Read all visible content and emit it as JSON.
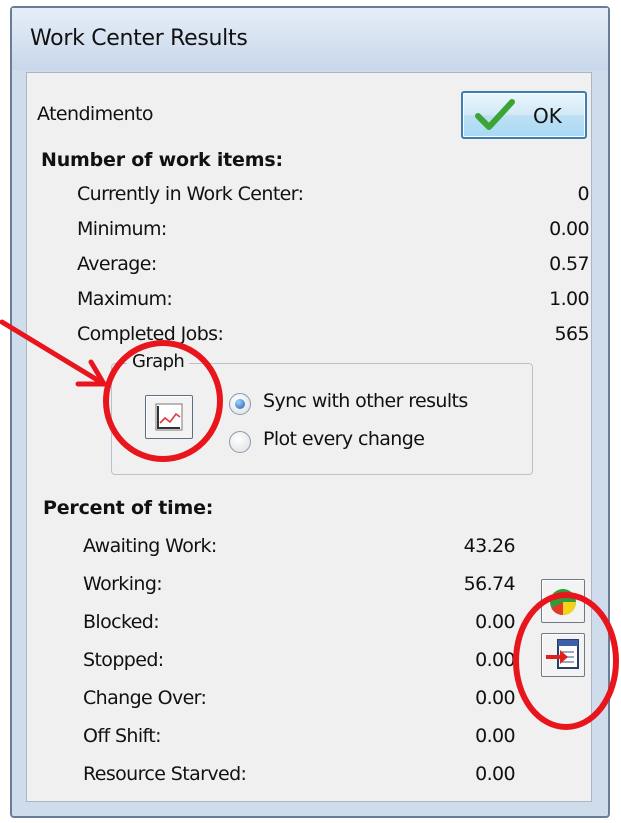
{
  "window": {
    "title": "Work Center Results"
  },
  "header": {
    "name": "Atendimento",
    "ok_label": "OK"
  },
  "work_items": {
    "heading": "Number of work items:",
    "rows": [
      {
        "label": "Currently in Work Center:",
        "value": "0"
      },
      {
        "label": "Minimum:",
        "value": "0.00"
      },
      {
        "label": "Average:",
        "value": "0.57"
      },
      {
        "label": "Maximum:",
        "value": "1.00"
      },
      {
        "label": "Completed Jobs:",
        "value": "565"
      }
    ]
  },
  "graph": {
    "legend": "Graph",
    "options": [
      {
        "label": "Sync with other results",
        "selected": true
      },
      {
        "label": "Plot every change",
        "selected": false
      }
    ]
  },
  "percent_time": {
    "heading": "Percent of time:",
    "rows": [
      {
        "label": "Awaiting Work:",
        "value": "43.26"
      },
      {
        "label": "Working:",
        "value": "56.74"
      },
      {
        "label": "Blocked:",
        "value": "0.00"
      },
      {
        "label": "Stopped:",
        "value": "0.00"
      },
      {
        "label": "Change Over:",
        "value": "0.00"
      },
      {
        "label": "Off Shift:",
        "value": "0.00"
      },
      {
        "label": "Resource Starved:",
        "value": "0.00"
      }
    ]
  },
  "colors": {
    "annotation": "#e8161c",
    "selected_radio": "#1d5fa6",
    "ok_check": "#3aa534"
  },
  "icons": {
    "ok": "checkmark-icon",
    "graph": "line-graph-icon",
    "pie": "pie-chart-icon",
    "export": "export-document-icon"
  }
}
